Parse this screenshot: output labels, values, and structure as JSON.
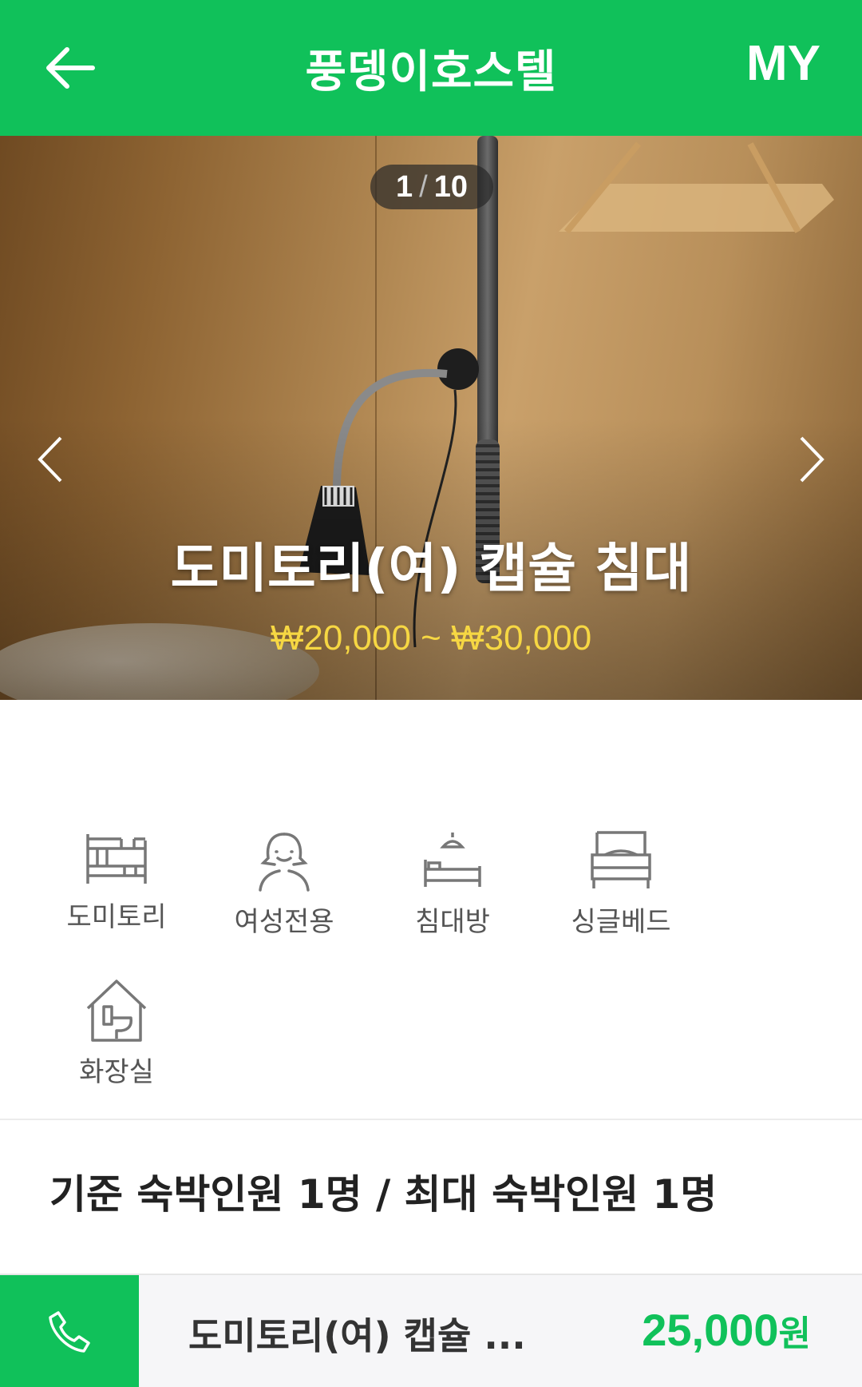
{
  "header": {
    "title": "풍뎅이호스텔",
    "my_label": "MY"
  },
  "hero": {
    "counter_current": "1",
    "counter_separator": "/",
    "counter_total": "10",
    "room_name": "도미토리(여) 캡슐 침대",
    "price_range": "₩20,000 ~ ₩30,000"
  },
  "features": [
    {
      "label": "도미토리",
      "icon": "bunk-bed-icon"
    },
    {
      "label": "여성전용",
      "icon": "female-icon"
    },
    {
      "label": "침대방",
      "icon": "bed-room-icon"
    },
    {
      "label": "싱글베드",
      "icon": "single-bed-icon"
    },
    {
      "label": "화장실",
      "icon": "toilet-icon"
    }
  ],
  "capacity_text": "기준 숙박인원 1명 / 최대 숙박인원 1명",
  "bottom_bar": {
    "room_name": "도미토리(여) 캡슐 ...",
    "price": "25,000",
    "unit": "원"
  },
  "colors": {
    "brand_green": "#10c15a",
    "price_yellow": "#f6d743"
  }
}
